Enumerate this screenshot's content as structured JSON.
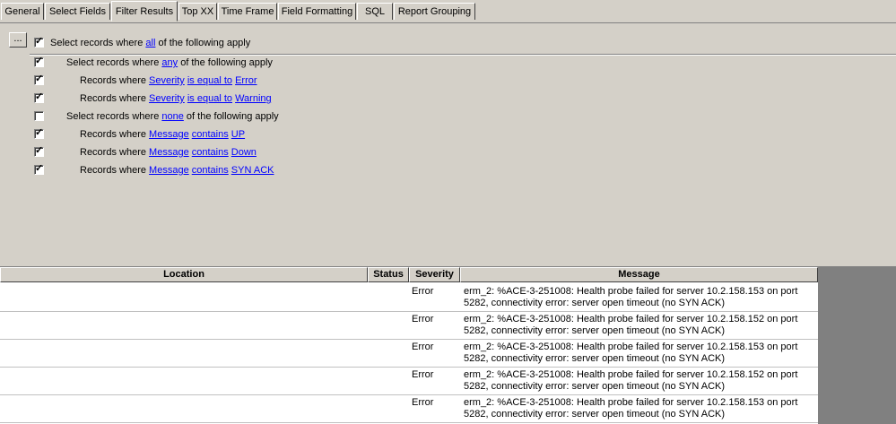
{
  "tabs": [
    {
      "label": "General",
      "active": false
    },
    {
      "label": "Select Fields",
      "active": false
    },
    {
      "label": "Filter Results",
      "active": true
    },
    {
      "label": "Top XX",
      "active": false
    },
    {
      "label": "Time Frame",
      "active": false
    },
    {
      "label": "Field Formatting",
      "active": false
    },
    {
      "label": "SQL",
      "active": false
    },
    {
      "label": "Report Grouping",
      "active": false
    }
  ],
  "filter": {
    "more_button": "...",
    "rules": [
      {
        "checked": true,
        "parts": [
          {
            "t": "Select records where "
          },
          {
            "t": "all",
            "link": true
          },
          {
            "t": " of the following apply"
          }
        ]
      },
      {
        "checked": true,
        "parts": [
          {
            "t": "Select records where "
          },
          {
            "t": "any",
            "link": true
          },
          {
            "t": " of the following apply"
          }
        ]
      },
      {
        "checked": true,
        "parts": [
          {
            "t": "Records where "
          },
          {
            "t": "Severity",
            "link": true
          },
          {
            "t": " "
          },
          {
            "t": "is equal to",
            "link": true
          },
          {
            "t": " "
          },
          {
            "t": "Error",
            "link": true
          }
        ]
      },
      {
        "checked": true,
        "parts": [
          {
            "t": "Records where "
          },
          {
            "t": "Severity",
            "link": true
          },
          {
            "t": " "
          },
          {
            "t": "is equal to",
            "link": true
          },
          {
            "t": " "
          },
          {
            "t": "Warning",
            "link": true
          }
        ]
      },
      {
        "checked": false,
        "parts": [
          {
            "t": "Select records where "
          },
          {
            "t": "none",
            "link": true
          },
          {
            "t": " of the following apply"
          }
        ]
      },
      {
        "checked": true,
        "parts": [
          {
            "t": "Records where "
          },
          {
            "t": "Message",
            "link": true
          },
          {
            "t": " "
          },
          {
            "t": "contains",
            "link": true
          },
          {
            "t": " "
          },
          {
            "t": "UP",
            "link": true
          }
        ]
      },
      {
        "checked": true,
        "parts": [
          {
            "t": "Records where "
          },
          {
            "t": "Message",
            "link": true
          },
          {
            "t": " "
          },
          {
            "t": "contains",
            "link": true
          },
          {
            "t": " "
          },
          {
            "t": "Down",
            "link": true
          }
        ]
      },
      {
        "checked": true,
        "parts": [
          {
            "t": "Records where "
          },
          {
            "t": "Message",
            "link": true
          },
          {
            "t": " "
          },
          {
            "t": "contains",
            "link": true
          },
          {
            "t": " "
          },
          {
            "t": "SYN ACK",
            "link": true
          }
        ]
      }
    ]
  },
  "grid": {
    "columns": [
      "Location",
      "Status",
      "Severity",
      "Message"
    ],
    "rows": [
      {
        "location": "",
        "status": "",
        "severity": "Error",
        "message_line1": "erm_2: %ACE-3-251008: Health probe failed for server 10.2.158.153 on port",
        "message_line2": "5282, connectivity error: server open timeout (no SYN ACK)"
      },
      {
        "location": "",
        "status": "",
        "severity": "Error",
        "message_line1": "erm_2: %ACE-3-251008: Health probe failed for server 10.2.158.152 on port",
        "message_line2": "5282, connectivity error: server open timeout (no SYN ACK)"
      },
      {
        "location": "",
        "status": "",
        "severity": "Error",
        "message_line1": "erm_2: %ACE-3-251008: Health probe failed for server 10.2.158.153 on port",
        "message_line2": "5282, connectivity error: server open timeout (no SYN ACK)"
      },
      {
        "location": "",
        "status": "",
        "severity": "Error",
        "message_line1": "erm_2: %ACE-3-251008: Health probe failed for server 10.2.158.152 on port",
        "message_line2": "5282, connectivity error: server open timeout (no SYN ACK)"
      },
      {
        "location": "",
        "status": "",
        "severity": "Error",
        "message_line1": "erm_2: %ACE-3-251008: Health probe failed for server 10.2.158.153 on port",
        "message_line2": "5282, connectivity error: server open timeout (no SYN ACK)"
      }
    ]
  }
}
